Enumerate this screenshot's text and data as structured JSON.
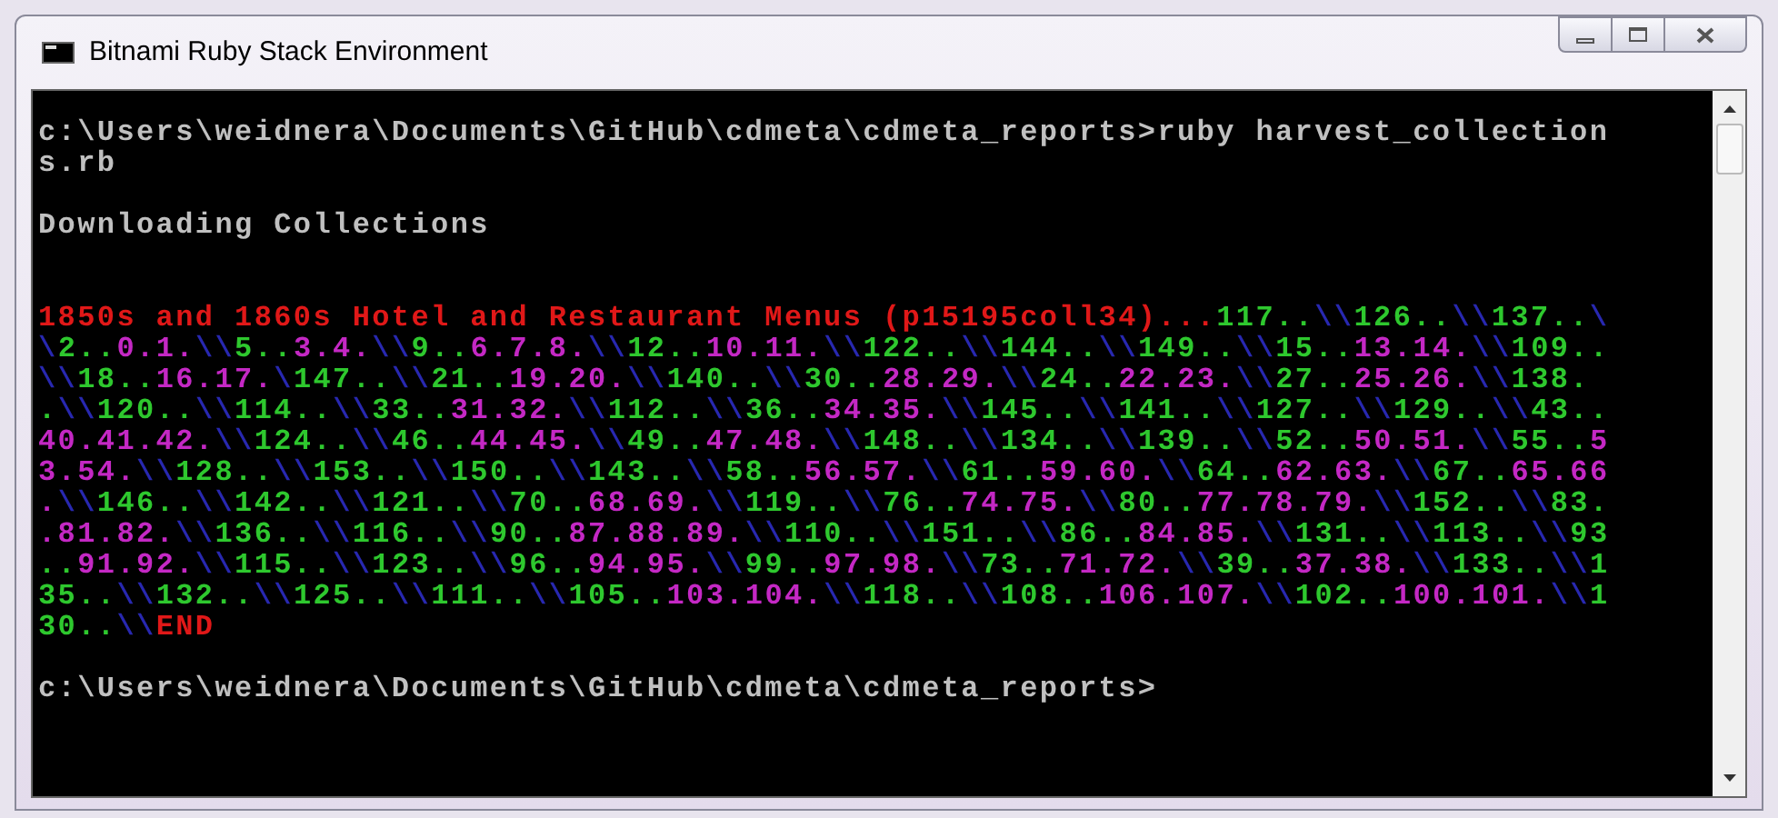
{
  "window": {
    "title": "Bitnami Ruby Stack Environment"
  },
  "console": [
    {
      "kind": "plain",
      "text": "c:\\Users\\weidnera\\Documents\\GitHub\\cdmeta\\cdmeta_reports>ruby harvest_collection"
    },
    {
      "kind": "plain",
      "text": "s.rb"
    },
    {
      "kind": "blank"
    },
    {
      "kind": "plain",
      "text": "Downloading Collections"
    },
    {
      "kind": "blank"
    },
    {
      "kind": "blank"
    },
    {
      "kind": "colored",
      "segments": [
        {
          "text": "1850s and 1860s Hotel and Restaurant Menus (p15195coll34)...",
          "color": "#e01818"
        },
        {
          "text": "117..",
          "color": "#2ec82e"
        },
        {
          "text": "\\\\",
          "color": "#2828b0"
        },
        {
          "text": "126..",
          "color": "#2ec82e"
        },
        {
          "text": "\\\\",
          "color": "#2828b0"
        },
        {
          "text": "137..",
          "color": "#2ec82e"
        },
        {
          "text": "\\",
          "color": "#2828b0"
        }
      ]
    },
    {
      "kind": "colored",
      "segments": [
        {
          "text": "\\",
          "color": "#2828b0"
        },
        {
          "text": "2..",
          "color": "#2ec82e"
        },
        {
          "text": "0.1.",
          "color": "#c428c4"
        },
        {
          "text": "\\\\",
          "color": "#2828b0"
        },
        {
          "text": "5..",
          "color": "#2ec82e"
        },
        {
          "text": "3.4.",
          "color": "#c428c4"
        },
        {
          "text": "\\\\",
          "color": "#2828b0"
        },
        {
          "text": "9..",
          "color": "#2ec82e"
        },
        {
          "text": "6.7.8.",
          "color": "#c428c4"
        },
        {
          "text": "\\\\",
          "color": "#2828b0"
        },
        {
          "text": "12..",
          "color": "#2ec82e"
        },
        {
          "text": "10.11.",
          "color": "#c428c4"
        },
        {
          "text": "\\\\",
          "color": "#2828b0"
        },
        {
          "text": "122..",
          "color": "#2ec82e"
        },
        {
          "text": "\\\\",
          "color": "#2828b0"
        },
        {
          "text": "144..",
          "color": "#2ec82e"
        },
        {
          "text": "\\\\",
          "color": "#2828b0"
        },
        {
          "text": "149..",
          "color": "#2ec82e"
        },
        {
          "text": "\\\\",
          "color": "#2828b0"
        },
        {
          "text": "15..",
          "color": "#2ec82e"
        },
        {
          "text": "13.14.",
          "color": "#c428c4"
        },
        {
          "text": "\\\\",
          "color": "#2828b0"
        },
        {
          "text": "109..",
          "color": "#2ec82e"
        }
      ]
    },
    {
      "kind": "colored",
      "segments": [
        {
          "text": "\\\\",
          "color": "#2828b0"
        },
        {
          "text": "18..",
          "color": "#2ec82e"
        },
        {
          "text": "16.17.",
          "color": "#c428c4"
        },
        {
          "text": "\\",
          "color": "#2828b0"
        },
        {
          "text": "147..",
          "color": "#2ec82e"
        },
        {
          "text": "\\\\",
          "color": "#2828b0"
        },
        {
          "text": "21..",
          "color": "#2ec82e"
        },
        {
          "text": "19.20.",
          "color": "#c428c4"
        },
        {
          "text": "\\\\",
          "color": "#2828b0"
        },
        {
          "text": "140..",
          "color": "#2ec82e"
        },
        {
          "text": "\\\\",
          "color": "#2828b0"
        },
        {
          "text": "30..",
          "color": "#2ec82e"
        },
        {
          "text": "28.29.",
          "color": "#c428c4"
        },
        {
          "text": "\\\\",
          "color": "#2828b0"
        },
        {
          "text": "24..",
          "color": "#2ec82e"
        },
        {
          "text": "22.23.",
          "color": "#c428c4"
        },
        {
          "text": "\\\\",
          "color": "#2828b0"
        },
        {
          "text": "27..",
          "color": "#2ec82e"
        },
        {
          "text": "25.26.",
          "color": "#c428c4"
        },
        {
          "text": "\\\\",
          "color": "#2828b0"
        },
        {
          "text": "138.",
          "color": "#2ec82e"
        }
      ]
    },
    {
      "kind": "colored",
      "segments": [
        {
          "text": ".",
          "color": "#2ec82e"
        },
        {
          "text": "\\\\",
          "color": "#2828b0"
        },
        {
          "text": "120..",
          "color": "#2ec82e"
        },
        {
          "text": "\\\\",
          "color": "#2828b0"
        },
        {
          "text": "114..",
          "color": "#2ec82e"
        },
        {
          "text": "\\\\",
          "color": "#2828b0"
        },
        {
          "text": "33..",
          "color": "#2ec82e"
        },
        {
          "text": "31.32.",
          "color": "#c428c4"
        },
        {
          "text": "\\\\",
          "color": "#2828b0"
        },
        {
          "text": "112..",
          "color": "#2ec82e"
        },
        {
          "text": "\\\\",
          "color": "#2828b0"
        },
        {
          "text": "36..",
          "color": "#2ec82e"
        },
        {
          "text": "34.35.",
          "color": "#c428c4"
        },
        {
          "text": "\\\\",
          "color": "#2828b0"
        },
        {
          "text": "145..",
          "color": "#2ec82e"
        },
        {
          "text": "\\\\",
          "color": "#2828b0"
        },
        {
          "text": "141..",
          "color": "#2ec82e"
        },
        {
          "text": "\\\\",
          "color": "#2828b0"
        },
        {
          "text": "127..",
          "color": "#2ec82e"
        },
        {
          "text": "\\\\",
          "color": "#2828b0"
        },
        {
          "text": "129..",
          "color": "#2ec82e"
        },
        {
          "text": "\\\\",
          "color": "#2828b0"
        },
        {
          "text": "43..",
          "color": "#2ec82e"
        }
      ]
    },
    {
      "kind": "colored",
      "segments": [
        {
          "text": "40.41.42.",
          "color": "#c428c4"
        },
        {
          "text": "\\\\",
          "color": "#2828b0"
        },
        {
          "text": "124..",
          "color": "#2ec82e"
        },
        {
          "text": "\\\\",
          "color": "#2828b0"
        },
        {
          "text": "46..",
          "color": "#2ec82e"
        },
        {
          "text": "44.45.",
          "color": "#c428c4"
        },
        {
          "text": "\\\\",
          "color": "#2828b0"
        },
        {
          "text": "49..",
          "color": "#2ec82e"
        },
        {
          "text": "47.48.",
          "color": "#c428c4"
        },
        {
          "text": "\\\\",
          "color": "#2828b0"
        },
        {
          "text": "148..",
          "color": "#2ec82e"
        },
        {
          "text": "\\\\",
          "color": "#2828b0"
        },
        {
          "text": "134..",
          "color": "#2ec82e"
        },
        {
          "text": "\\\\",
          "color": "#2828b0"
        },
        {
          "text": "139..",
          "color": "#2ec82e"
        },
        {
          "text": "\\\\",
          "color": "#2828b0"
        },
        {
          "text": "52..",
          "color": "#2ec82e"
        },
        {
          "text": "50.51.",
          "color": "#c428c4"
        },
        {
          "text": "\\\\",
          "color": "#2828b0"
        },
        {
          "text": "55..",
          "color": "#2ec82e"
        },
        {
          "text": "5",
          "color": "#c428c4"
        }
      ]
    },
    {
      "kind": "colored",
      "segments": [
        {
          "text": "3.54.",
          "color": "#c428c4"
        },
        {
          "text": "\\\\",
          "color": "#2828b0"
        },
        {
          "text": "128..",
          "color": "#2ec82e"
        },
        {
          "text": "\\\\",
          "color": "#2828b0"
        },
        {
          "text": "153..",
          "color": "#2ec82e"
        },
        {
          "text": "\\\\",
          "color": "#2828b0"
        },
        {
          "text": "150..",
          "color": "#2ec82e"
        },
        {
          "text": "\\\\",
          "color": "#2828b0"
        },
        {
          "text": "143..",
          "color": "#2ec82e"
        },
        {
          "text": "\\\\",
          "color": "#2828b0"
        },
        {
          "text": "58..",
          "color": "#2ec82e"
        },
        {
          "text": "56.57.",
          "color": "#c428c4"
        },
        {
          "text": "\\\\",
          "color": "#2828b0"
        },
        {
          "text": "61..",
          "color": "#2ec82e"
        },
        {
          "text": "59.60.",
          "color": "#c428c4"
        },
        {
          "text": "\\\\",
          "color": "#2828b0"
        },
        {
          "text": "64..",
          "color": "#2ec82e"
        },
        {
          "text": "62.63.",
          "color": "#c428c4"
        },
        {
          "text": "\\\\",
          "color": "#2828b0"
        },
        {
          "text": "67..",
          "color": "#2ec82e"
        },
        {
          "text": "65.66",
          "color": "#c428c4"
        }
      ]
    },
    {
      "kind": "colored",
      "segments": [
        {
          "text": ".",
          "color": "#c428c4"
        },
        {
          "text": "\\\\",
          "color": "#2828b0"
        },
        {
          "text": "146..",
          "color": "#2ec82e"
        },
        {
          "text": "\\\\",
          "color": "#2828b0"
        },
        {
          "text": "142..",
          "color": "#2ec82e"
        },
        {
          "text": "\\\\",
          "color": "#2828b0"
        },
        {
          "text": "121..",
          "color": "#2ec82e"
        },
        {
          "text": "\\\\",
          "color": "#2828b0"
        },
        {
          "text": "70..",
          "color": "#2ec82e"
        },
        {
          "text": "68.69.",
          "color": "#c428c4"
        },
        {
          "text": "\\\\",
          "color": "#2828b0"
        },
        {
          "text": "119..",
          "color": "#2ec82e"
        },
        {
          "text": "\\\\",
          "color": "#2828b0"
        },
        {
          "text": "76..",
          "color": "#2ec82e"
        },
        {
          "text": "74.75.",
          "color": "#c428c4"
        },
        {
          "text": "\\\\",
          "color": "#2828b0"
        },
        {
          "text": "80..",
          "color": "#2ec82e"
        },
        {
          "text": "77.78.79.",
          "color": "#c428c4"
        },
        {
          "text": "\\\\",
          "color": "#2828b0"
        },
        {
          "text": "152..",
          "color": "#2ec82e"
        },
        {
          "text": "\\\\",
          "color": "#2828b0"
        },
        {
          "text": "83.",
          "color": "#2ec82e"
        }
      ]
    },
    {
      "kind": "colored",
      "segments": [
        {
          "text": ".81.82.",
          "color": "#c428c4"
        },
        {
          "text": "\\\\",
          "color": "#2828b0"
        },
        {
          "text": "136..",
          "color": "#2ec82e"
        },
        {
          "text": "\\\\",
          "color": "#2828b0"
        },
        {
          "text": "116..",
          "color": "#2ec82e"
        },
        {
          "text": "\\\\",
          "color": "#2828b0"
        },
        {
          "text": "90..",
          "color": "#2ec82e"
        },
        {
          "text": "87.88.89.",
          "color": "#c428c4"
        },
        {
          "text": "\\\\",
          "color": "#2828b0"
        },
        {
          "text": "110..",
          "color": "#2ec82e"
        },
        {
          "text": "\\\\",
          "color": "#2828b0"
        },
        {
          "text": "151..",
          "color": "#2ec82e"
        },
        {
          "text": "\\\\",
          "color": "#2828b0"
        },
        {
          "text": "86..",
          "color": "#2ec82e"
        },
        {
          "text": "84.85.",
          "color": "#c428c4"
        },
        {
          "text": "\\\\",
          "color": "#2828b0"
        },
        {
          "text": "131..",
          "color": "#2ec82e"
        },
        {
          "text": "\\\\",
          "color": "#2828b0"
        },
        {
          "text": "113..",
          "color": "#2ec82e"
        },
        {
          "text": "\\\\",
          "color": "#2828b0"
        },
        {
          "text": "93",
          "color": "#2ec82e"
        }
      ]
    },
    {
      "kind": "colored",
      "segments": [
        {
          "text": "..",
          "color": "#2ec82e"
        },
        {
          "text": "91.92.",
          "color": "#c428c4"
        },
        {
          "text": "\\\\",
          "color": "#2828b0"
        },
        {
          "text": "115..",
          "color": "#2ec82e"
        },
        {
          "text": "\\\\",
          "color": "#2828b0"
        },
        {
          "text": "123..",
          "color": "#2ec82e"
        },
        {
          "text": "\\\\",
          "color": "#2828b0"
        },
        {
          "text": "96..",
          "color": "#2ec82e"
        },
        {
          "text": "94.95.",
          "color": "#c428c4"
        },
        {
          "text": "\\\\",
          "color": "#2828b0"
        },
        {
          "text": "99..",
          "color": "#2ec82e"
        },
        {
          "text": "97.98.",
          "color": "#c428c4"
        },
        {
          "text": "\\\\",
          "color": "#2828b0"
        },
        {
          "text": "73..",
          "color": "#2ec82e"
        },
        {
          "text": "71.72.",
          "color": "#c428c4"
        },
        {
          "text": "\\\\",
          "color": "#2828b0"
        },
        {
          "text": "39..",
          "color": "#2ec82e"
        },
        {
          "text": "37.38.",
          "color": "#c428c4"
        },
        {
          "text": "\\\\",
          "color": "#2828b0"
        },
        {
          "text": "133..",
          "color": "#2ec82e"
        },
        {
          "text": "\\\\",
          "color": "#2828b0"
        },
        {
          "text": "1",
          "color": "#2ec82e"
        }
      ]
    },
    {
      "kind": "colored",
      "segments": [
        {
          "text": "35..",
          "color": "#2ec82e"
        },
        {
          "text": "\\\\",
          "color": "#2828b0"
        },
        {
          "text": "132..",
          "color": "#2ec82e"
        },
        {
          "text": "\\\\",
          "color": "#2828b0"
        },
        {
          "text": "125..",
          "color": "#2ec82e"
        },
        {
          "text": "\\\\",
          "color": "#2828b0"
        },
        {
          "text": "111..",
          "color": "#2ec82e"
        },
        {
          "text": "\\\\",
          "color": "#2828b0"
        },
        {
          "text": "105..",
          "color": "#2ec82e"
        },
        {
          "text": "103.104.",
          "color": "#c428c4"
        },
        {
          "text": "\\\\",
          "color": "#2828b0"
        },
        {
          "text": "118..",
          "color": "#2ec82e"
        },
        {
          "text": "\\\\",
          "color": "#2828b0"
        },
        {
          "text": "108..",
          "color": "#2ec82e"
        },
        {
          "text": "106.107.",
          "color": "#c428c4"
        },
        {
          "text": "\\\\",
          "color": "#2828b0"
        },
        {
          "text": "102..",
          "color": "#2ec82e"
        },
        {
          "text": "100.101.",
          "color": "#c428c4"
        },
        {
          "text": "\\\\",
          "color": "#2828b0"
        },
        {
          "text": "1",
          "color": "#2ec82e"
        }
      ]
    },
    {
      "kind": "colored",
      "segments": [
        {
          "text": "30..",
          "color": "#2ec82e"
        },
        {
          "text": "\\\\",
          "color": "#2828b0"
        },
        {
          "text": "END",
          "color": "#e01818"
        }
      ]
    },
    {
      "kind": "blank"
    },
    {
      "kind": "plain",
      "text": "c:\\Users\\weidnera\\Documents\\GitHub\\cdmeta\\cdmeta_reports>"
    }
  ]
}
